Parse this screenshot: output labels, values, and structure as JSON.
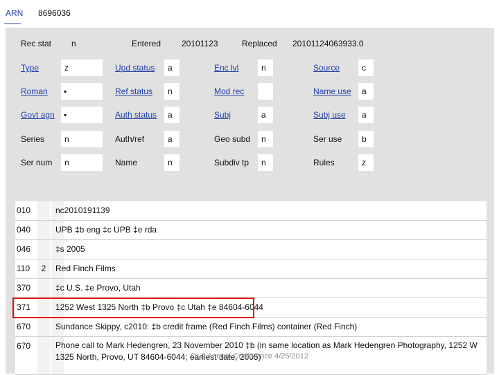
{
  "record": {
    "label": "ARN",
    "value": "8696036"
  },
  "fixed_fields": {
    "rec_stat_label": "Rec stat",
    "rec_stat_value": "n",
    "entered_label": "Entered",
    "entered_value": "20101123",
    "replaced_label": "Replaced",
    "replaced_value": "20101124063933.0",
    "rows": [
      {
        "c1l": "Type",
        "c1v": "z",
        "c2l": "Upd status",
        "c2v": "a",
        "c3l": "Enc lvl",
        "c3v": "n",
        "c4l": "Source",
        "c4v": "c"
      },
      {
        "c1l": "Roman",
        "c1v": "▪",
        "c2l": "Ref status",
        "c2v": "n",
        "c3l": "Mod rec",
        "c3v": "",
        "c4l": "Name use",
        "c4v": "a"
      },
      {
        "c1l": "Govt agn",
        "c1v": "▪",
        "c2l": "Auth status",
        "c2v": "a",
        "c3l": "Subj",
        "c3v": "a",
        "c4l": "Subj use",
        "c4v": "a"
      },
      {
        "c1l": "Series",
        "c1v": "n",
        "c2l": "Auth/ref",
        "c2v": "a",
        "c3l": "Geo subd",
        "c3v": "n",
        "c4l": "Ser use",
        "c4v": "b"
      },
      {
        "c1l": "Ser num",
        "c1v": "n",
        "c2l": "Name",
        "c2v": "n",
        "c3l": "Subdiv tp",
        "c3v": "n",
        "c4l": "Rules",
        "c4v": "z"
      }
    ]
  },
  "fields": [
    {
      "tag": "010",
      "ind1": "",
      "ind2": "",
      "content": "nc2010191139"
    },
    {
      "tag": "040",
      "ind1": "",
      "ind2": "",
      "content": "UPB ‡b eng ‡c UPB ‡e rda"
    },
    {
      "tag": "046",
      "ind1": "",
      "ind2": "",
      "content": "‡s 2005"
    },
    {
      "tag": "110",
      "ind1": "2",
      "ind2": "",
      "content": "Red Finch Films"
    },
    {
      "tag": "370",
      "ind1": "",
      "ind2": "",
      "content": "‡c U.S. ‡e Provo, Utah"
    },
    {
      "tag": "371",
      "ind1": "",
      "ind2": "",
      "content": "1252 West 1325 North ‡b Provo ‡c Utah ‡e 84604-6044"
    },
    {
      "tag": "670",
      "ind1": "",
      "ind2": "",
      "content": "Sundance Skippy, c2010: ‡b credit frame (Red Finch Films) container (Red Finch)"
    },
    {
      "tag": "670",
      "ind1": "",
      "ind2": "",
      "content": "Phone call to Mark Hedengren, 23 November 2010 ‡b (in same location as Mark Hedengren Photography, 1252 W 1325 North, Provo, UT 84604-6044; earliest date, 2005)"
    }
  ],
  "footer": "OLA Annual Conference 4/25/2012",
  "colors": {
    "link": "#1f3fa8",
    "highlight": "#e01010",
    "panel": "#e1e1e1"
  }
}
